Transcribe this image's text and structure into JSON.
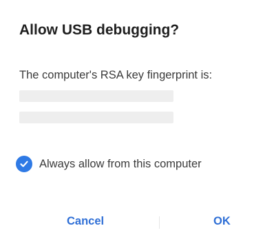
{
  "dialog": {
    "title": "Allow USB debugging?",
    "message": "The computer's RSA key fingerprint is:",
    "checkbox": {
      "label": "Always allow from this computer",
      "checked": true,
      "color": "#2f7ae5"
    },
    "buttons": {
      "cancel": "Cancel",
      "ok": "OK",
      "color": "#2f6fd6"
    }
  }
}
